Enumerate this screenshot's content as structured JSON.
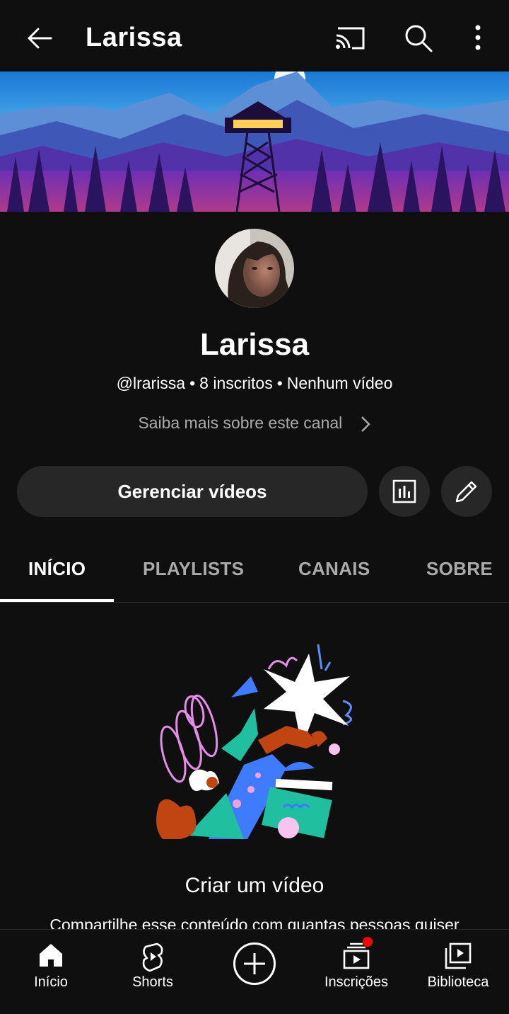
{
  "app_bar": {
    "title": "Larissa",
    "icons": [
      "back-arrow-icon",
      "cast-icon",
      "search-icon",
      "more-vert-icon"
    ]
  },
  "channel": {
    "name": "Larissa",
    "handle": "@lrarissa",
    "subscribers": "8 inscritos",
    "videos": "Nenhum vídeo",
    "separator": "•",
    "about_link": "Saiba mais sobre este canal"
  },
  "actions": {
    "manage_videos": "Gerenciar vídeos"
  },
  "tabs": [
    {
      "label": "INÍCIO",
      "active": true
    },
    {
      "label": "PLAYLISTS",
      "active": false
    },
    {
      "label": "CANAIS",
      "active": false
    },
    {
      "label": "SOBRE",
      "active": false
    }
  ],
  "empty_state": {
    "title": "Criar um vídeo",
    "subtitle": "Compartilhe esse conteúdo com quantas pessoas quiser"
  },
  "bottom_nav": [
    {
      "label": "Início",
      "icon": "home-icon"
    },
    {
      "label": "Shorts",
      "icon": "shorts-icon"
    },
    {
      "label": "",
      "icon": "create-plus-icon"
    },
    {
      "label": "Inscrições",
      "icon": "subscriptions-icon",
      "has_notification": true
    },
    {
      "label": "Biblioteca",
      "icon": "library-icon"
    }
  ],
  "colors": {
    "background": "#0f0f0f",
    "button_bg": "#272727",
    "secondary_text": "#aaaaaa",
    "notification": "#ff0000"
  }
}
